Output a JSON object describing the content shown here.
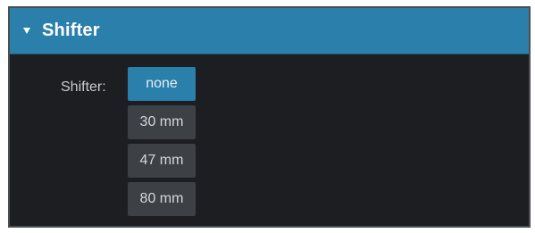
{
  "panel": {
    "title": "Shifter",
    "expanded": true
  },
  "shifter": {
    "label": "Shifter:",
    "selected": "none",
    "options": [
      {
        "label": "none",
        "selected": true
      },
      {
        "label": "30 mm",
        "selected": false
      },
      {
        "label": "47 mm",
        "selected": false
      },
      {
        "label": "80 mm",
        "selected": false
      }
    ]
  },
  "colors": {
    "header_bg": "#2a7fab",
    "panel_bg": "#1c1e22",
    "option_bg": "#3d4045",
    "selected_bg": "#2a7fab"
  }
}
